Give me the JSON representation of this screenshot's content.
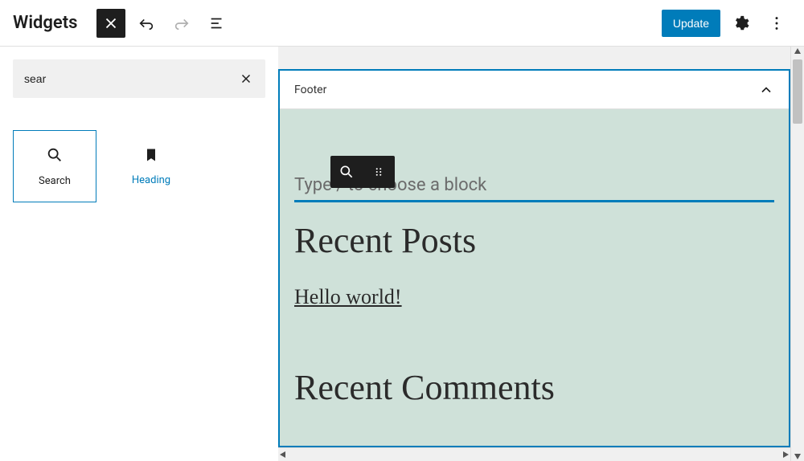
{
  "topbar": {
    "title": "Widgets",
    "update_label": "Update"
  },
  "sidebar": {
    "search_value": "sear",
    "blocks": [
      {
        "label": "Search"
      },
      {
        "label": "Heading"
      }
    ]
  },
  "canvas": {
    "panel_title": "Footer",
    "block_placeholder": "Type / to choose a block",
    "headings": {
      "recent_posts": "Recent Posts",
      "recent_comments": "Recent Comments"
    },
    "post_link": "Hello world!"
  }
}
